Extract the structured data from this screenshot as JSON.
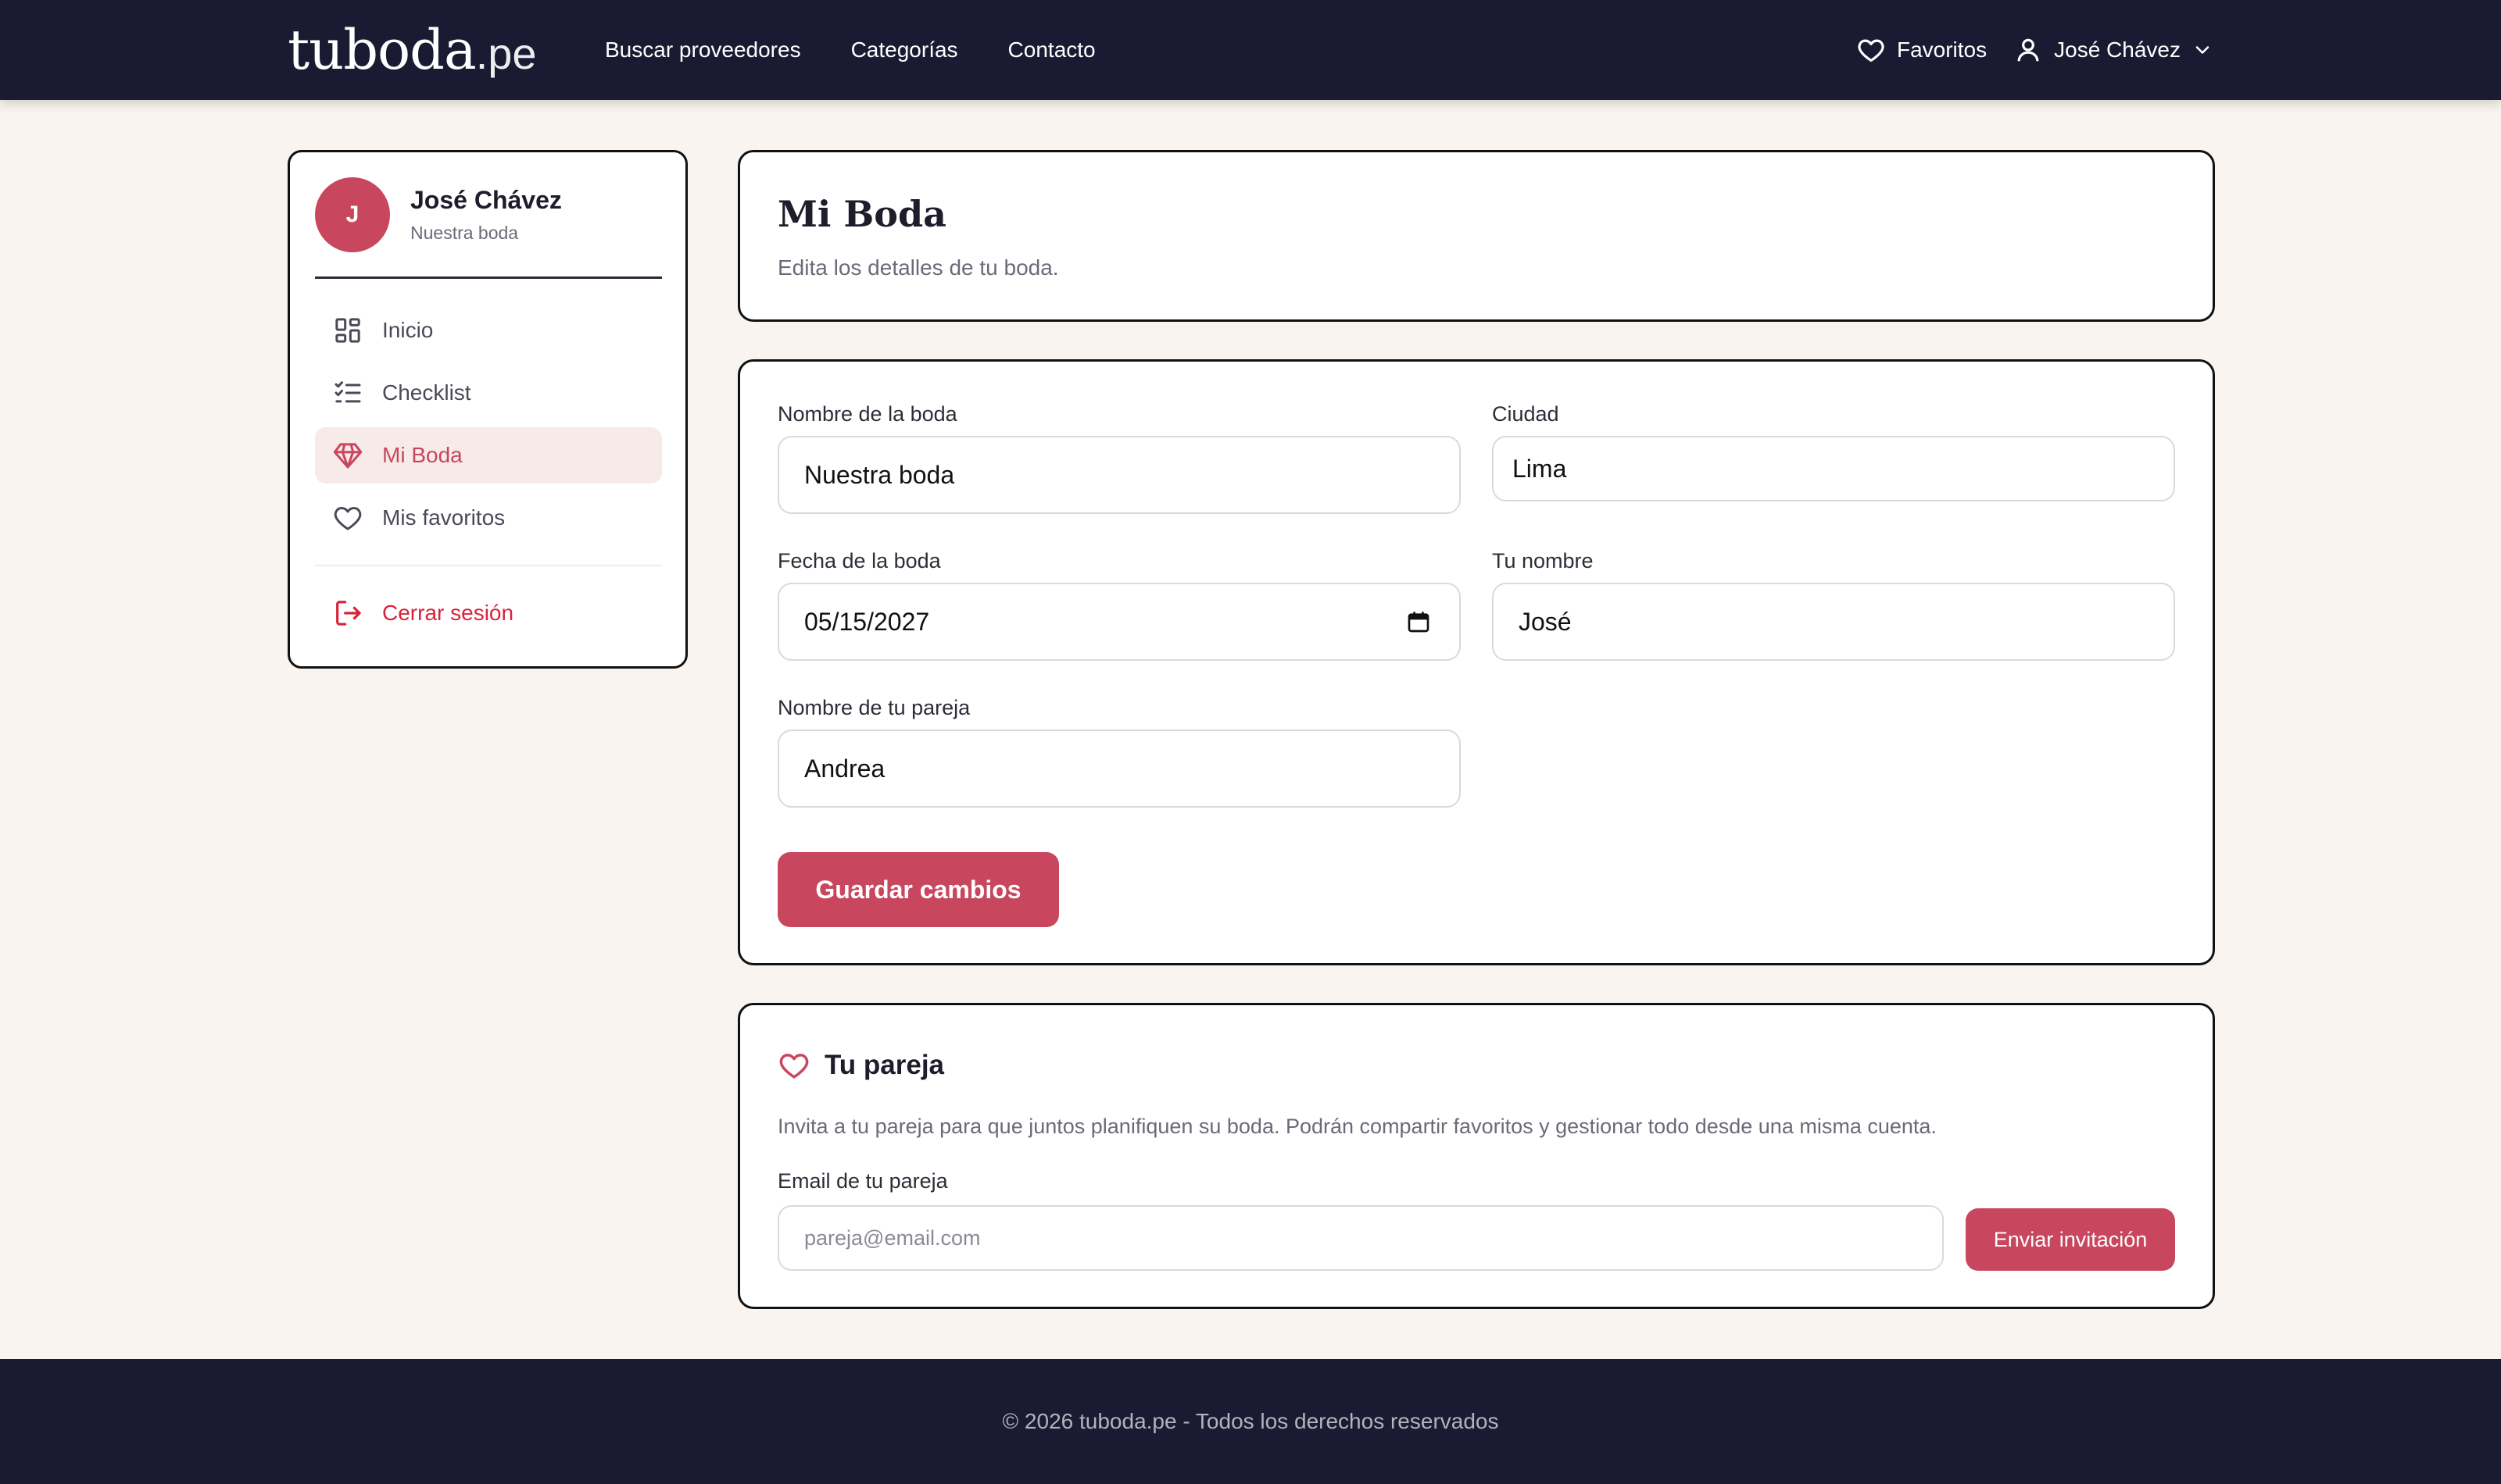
{
  "brand": {
    "name_main": "tuboda",
    "name_tld": ".pe"
  },
  "nav": {
    "links": [
      "Buscar proveedores",
      "Categorías",
      "Contacto"
    ]
  },
  "header": {
    "favorites_label": "Favoritos",
    "user_name": "José Chávez",
    "icons": [
      "heart-icon",
      "user-icon",
      "chevron-down-icon"
    ]
  },
  "sidebar": {
    "avatar_initial": "J",
    "user_name": "José Chávez",
    "user_sub": "Nuestra boda",
    "items": [
      {
        "label": "Inicio",
        "icon": "grid-icon",
        "active": false
      },
      {
        "label": "Checklist",
        "icon": "checklist-icon",
        "active": false
      },
      {
        "label": "Mi Boda",
        "icon": "diamond-icon",
        "active": true
      },
      {
        "label": "Mis favoritos",
        "icon": "heart-icon",
        "active": false
      }
    ],
    "logout_label": "Cerrar sesión"
  },
  "page": {
    "title": "Mi Boda",
    "subtitle": "Edita los detalles de tu boda."
  },
  "form": {
    "wedding_name": {
      "label": "Nombre de la boda",
      "value": "Nuestra boda"
    },
    "city": {
      "label": "Ciudad",
      "value": "Lima"
    },
    "date": {
      "label": "Fecha de la boda",
      "value": "05/15/2027"
    },
    "your_name": {
      "label": "Tu nombre",
      "value": "José"
    },
    "partner_name": {
      "label": "Nombre de tu pareja",
      "value": "Andrea"
    },
    "save_label": "Guardar cambios"
  },
  "partner": {
    "title": "Tu pareja",
    "description": "Invita a tu pareja para que juntos planifiquen su boda. Podrán compartir favoritos y gestionar todo desde una misma cuenta.",
    "email_label": "Email de tu pareja",
    "email_placeholder": "pareja@email.com",
    "invite_label": "Enviar invitación"
  },
  "footer": {
    "text": "© 2026 tuboda.pe - Todos los derechos reservados"
  },
  "colors": {
    "navy": "#1a1b32",
    "accent": "#c9475e",
    "background": "#f9f4ef",
    "logout": "#d8233a",
    "active_bg": "#f6ebe8"
  }
}
